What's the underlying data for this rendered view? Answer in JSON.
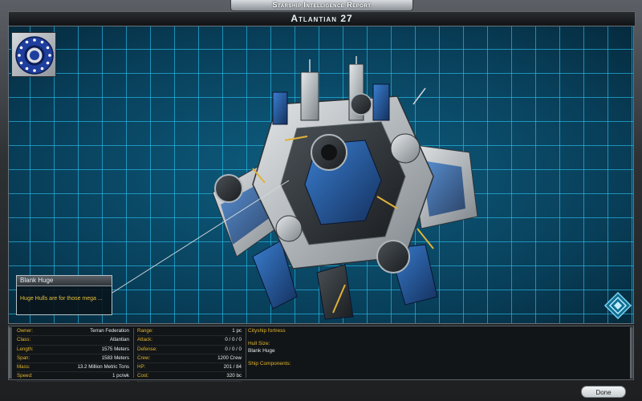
{
  "window": {
    "title": "Starship Intelligence Report",
    "ship_name": "Atlantian 27"
  },
  "tooltip": {
    "title": "Blank Huge",
    "text": "Huge Hulls are for those mega ..."
  },
  "stats_left": [
    {
      "label": "Owner:",
      "value": "Terran Federation"
    },
    {
      "label": "Class:",
      "value": "Atlantian"
    },
    {
      "label": "Length:",
      "value": "1575 Meters"
    },
    {
      "label": "Span:",
      "value": "1583 Meters"
    },
    {
      "label": "Mass:",
      "value": "13.2 Million Metric Tons"
    },
    {
      "label": "Speed:",
      "value": "1 pc/wk"
    }
  ],
  "stats_right": [
    {
      "label": "Range:",
      "value": "1 pc"
    },
    {
      "label": "Attack:",
      "value": "0 / 0 / 0"
    },
    {
      "label": "Defense:",
      "value": "0 / 0 / 0"
    },
    {
      "label": "Crew:",
      "value": "1200 Crew"
    },
    {
      "label": "HP:",
      "value": "201 / 84"
    },
    {
      "label": "Cost:",
      "value": "320 bc"
    }
  ],
  "description": {
    "title": "Cityship fortress",
    "hull_size_label": "Hull Size:",
    "hull_size_value": "Blank Huge",
    "components_label": "Ship Components:"
  },
  "buttons": {
    "done": "Done"
  },
  "colors": {
    "grid_line": "#28beeb",
    "grid_bg": "#083d57",
    "label_yellow": "#e3b52e",
    "emblem_blue": "#2a4fb0"
  },
  "icons": [
    "faction-emblem-icon",
    "rotate-view-icon"
  ]
}
